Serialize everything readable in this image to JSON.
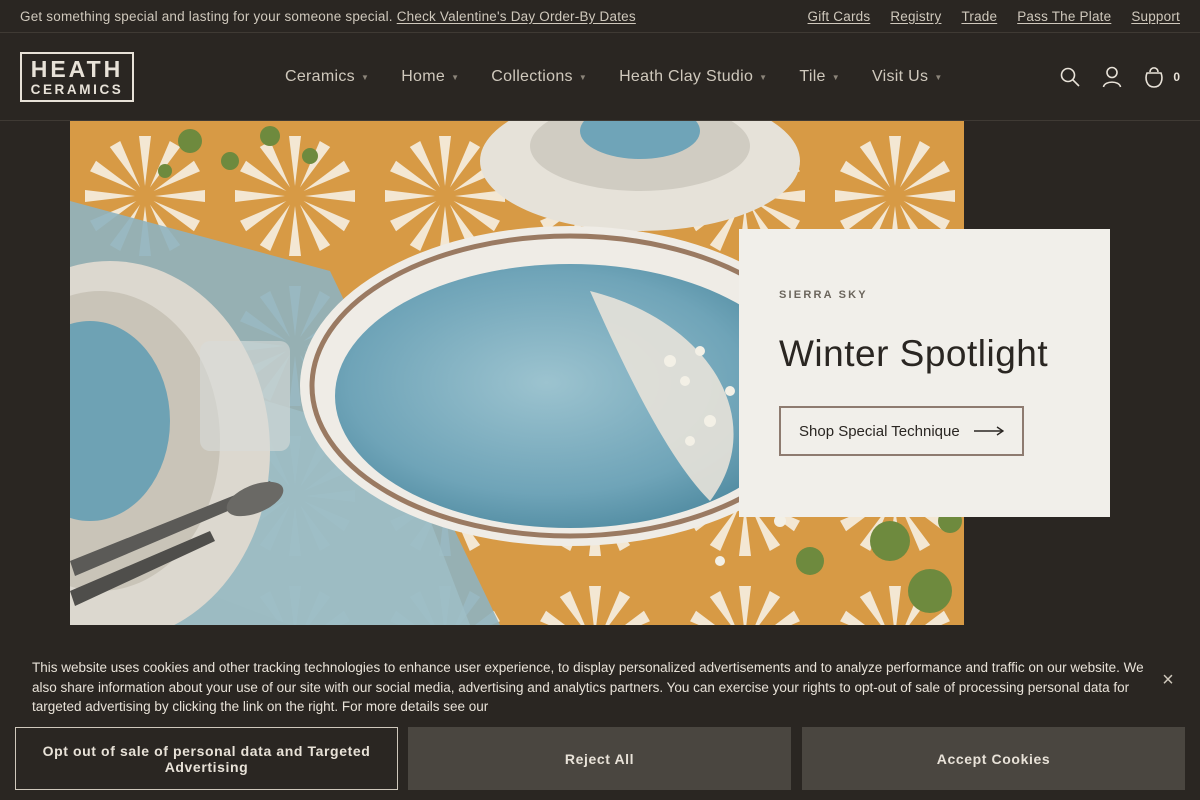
{
  "topbar": {
    "promo_text": "Get something special and lasting for your someone special.",
    "promo_link": "Check Valentine's Day Order-By Dates",
    "links": [
      "Gift Cards",
      "Registry",
      "Trade",
      "Pass The Plate",
      "Support"
    ]
  },
  "header": {
    "logo_line1": "HEATH",
    "logo_line2": "CERAMICS",
    "nav": [
      "Ceramics",
      "Home",
      "Collections",
      "Heath Clay Studio",
      "Tile",
      "Visit Us"
    ],
    "cart_count": "0"
  },
  "hero": {
    "eyebrow": "SIERRA SKY",
    "title": "Winter Spotlight",
    "cta": "Shop Special Technique"
  },
  "cookie": {
    "text": "This website uses cookies and other tracking technologies to enhance user experience, to display personalized advertisements and to analyze performance and traffic on our website. We also share information about your use of our site with our social media, advertising and analytics partners. You can exercise your rights to opt-out of sale of processing personal data for targeted advertising by clicking the link on the right. For more details see our",
    "opt_out": "Opt out of sale of personal data and Targeted Advertising",
    "reject": "Reject All",
    "accept": "Accept Cookies",
    "close": "×"
  },
  "colors": {
    "background": "#2a2622",
    "card": "#f1efea",
    "button": "#4a4640"
  }
}
